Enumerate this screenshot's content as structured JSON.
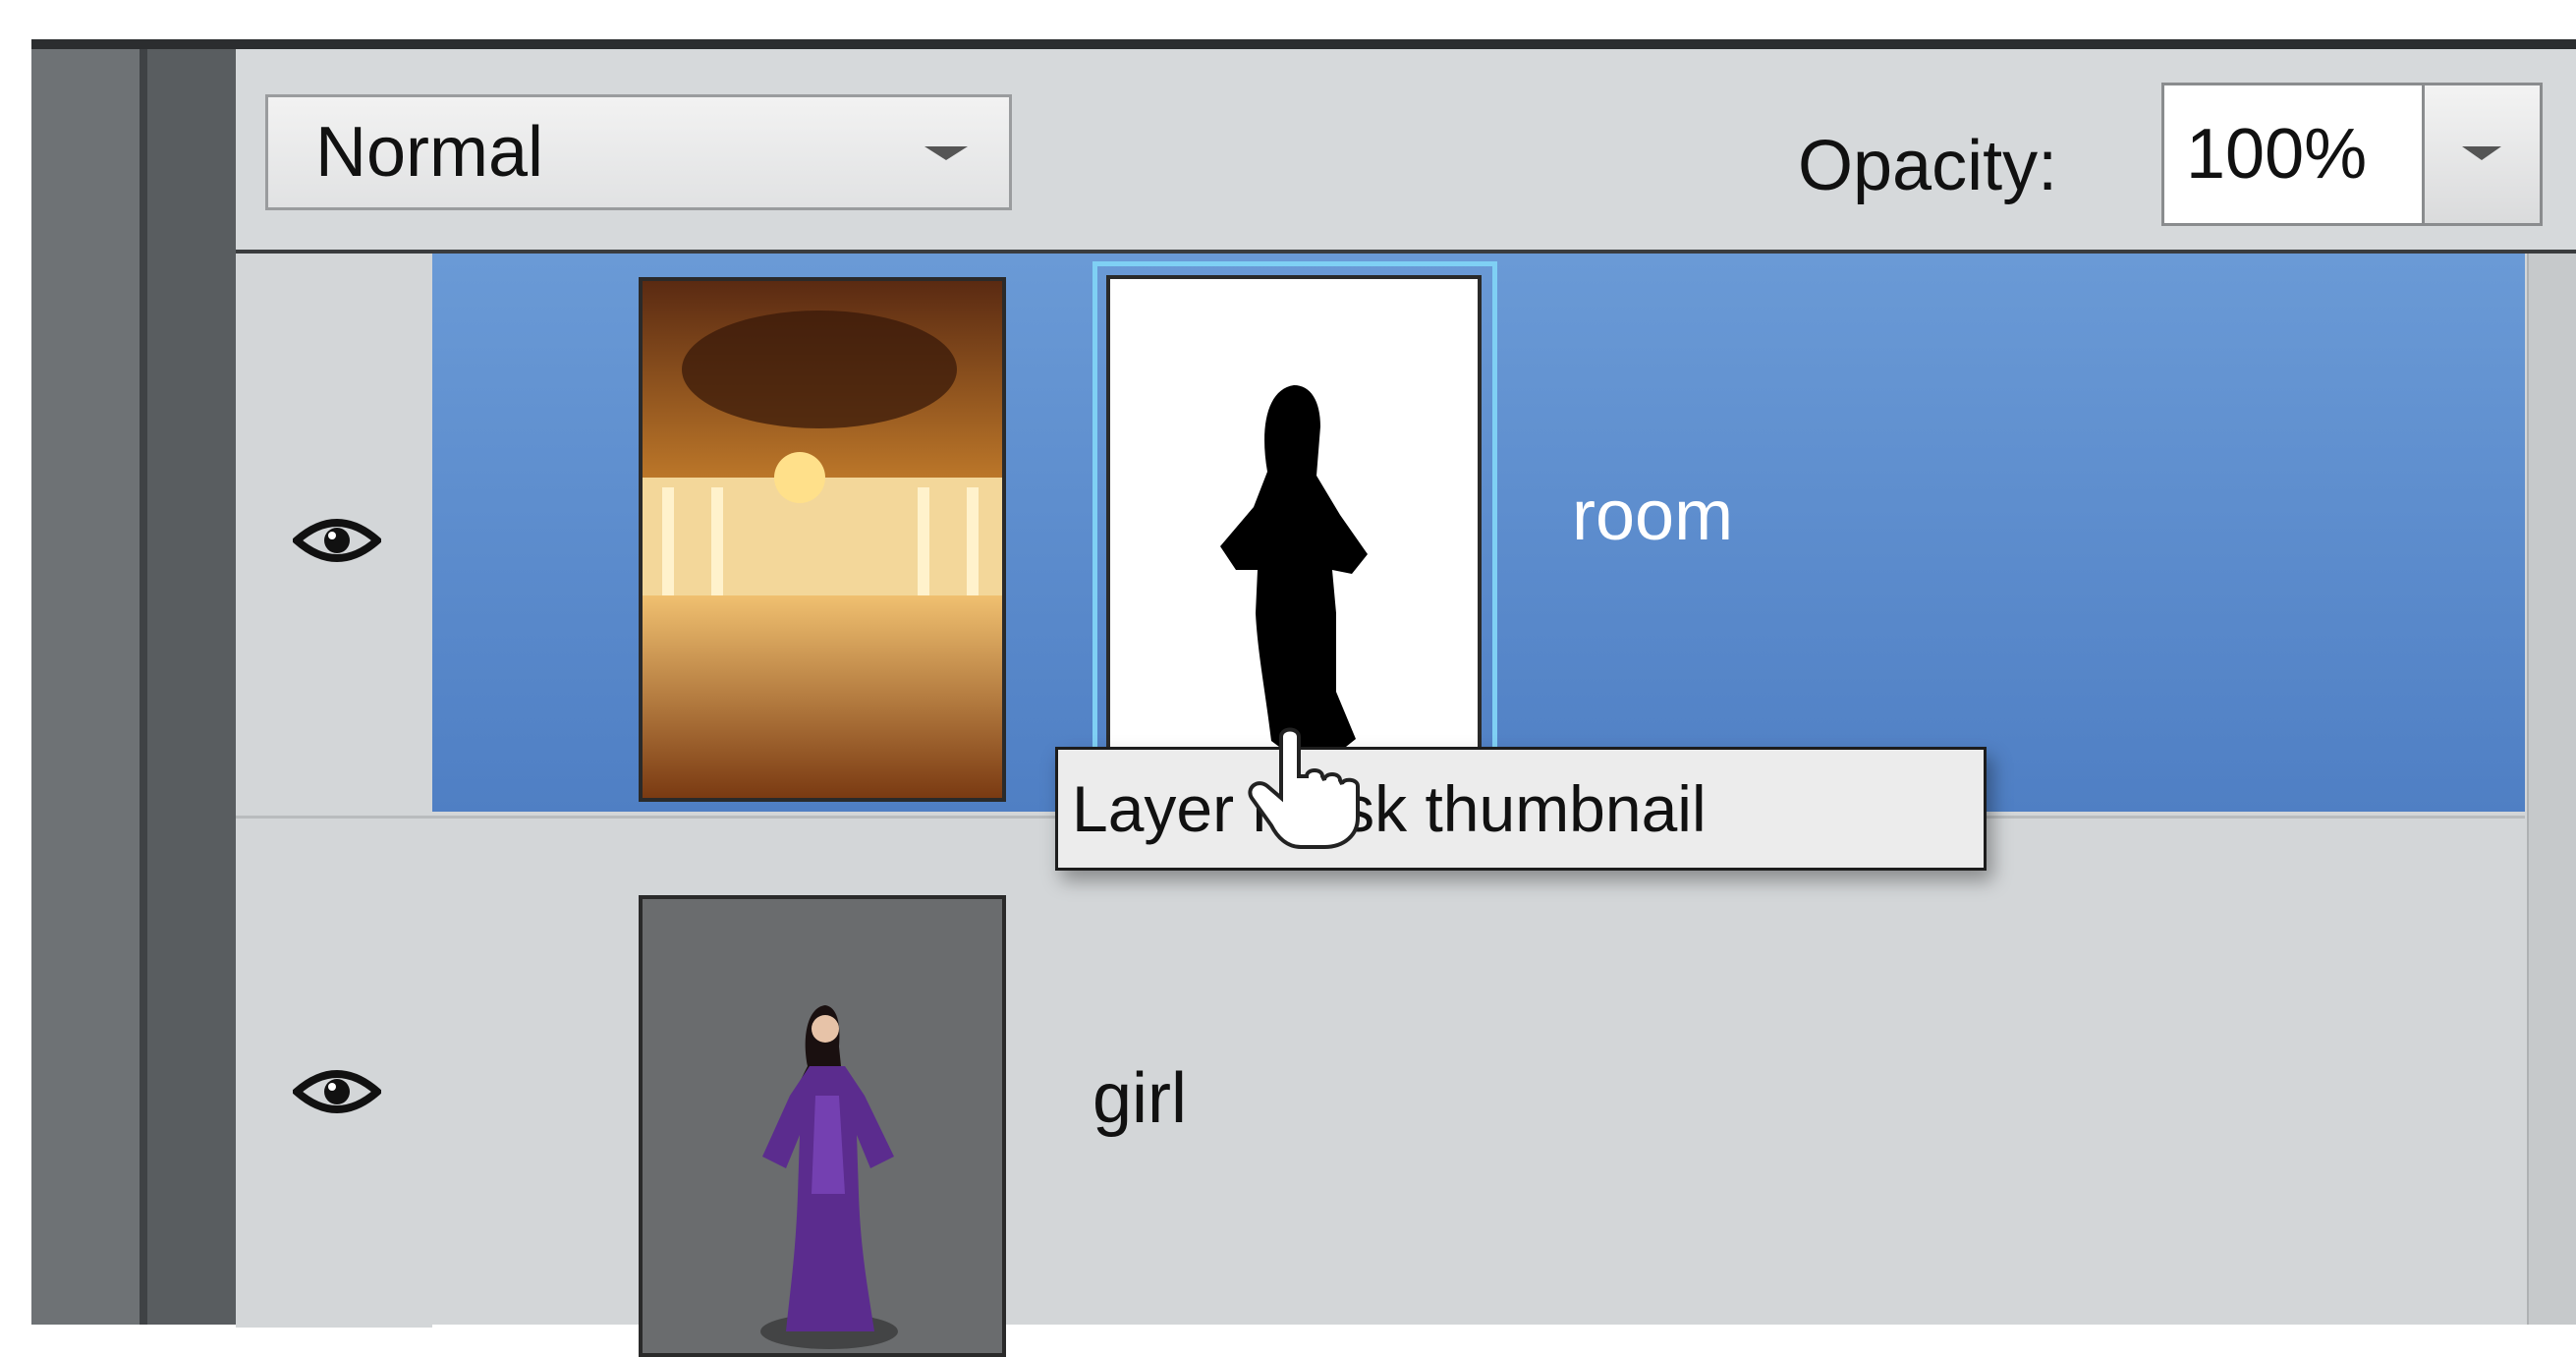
{
  "toolbar": {
    "blend_mode": {
      "selected": "Normal",
      "icon": "chevron-down-icon"
    },
    "opacity": {
      "label": "Opacity:",
      "value": "100%",
      "icon": "chevron-down-icon"
    }
  },
  "layers": [
    {
      "name": "room",
      "selected": true,
      "visible": true,
      "has_mask": true,
      "icons": [
        "eye-icon",
        "link-icon",
        "chain-link-icon"
      ]
    },
    {
      "name": "girl",
      "selected": false,
      "visible": true,
      "has_mask": false,
      "icons": [
        "eye-icon",
        "link-icon"
      ]
    }
  ],
  "tooltip": {
    "text": "Layer mask thumbnail"
  },
  "colors": {
    "selection": "#5b8bcc",
    "panel": "#d3d6d8",
    "mask_highlight": "#7fd0f4",
    "link_active": "#e6a23a"
  }
}
